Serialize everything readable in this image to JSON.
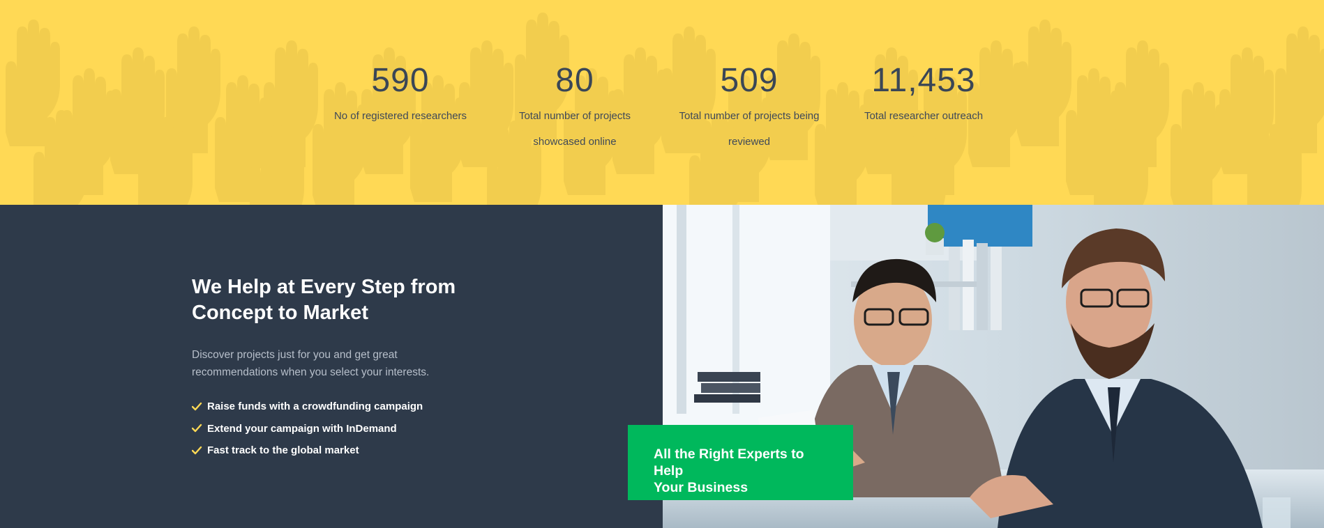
{
  "stats": [
    {
      "number": "590",
      "label_lines": [
        "No of registered researchers"
      ]
    },
    {
      "number": "80",
      "label_lines": [
        "Total number of projects",
        "showcased online"
      ]
    },
    {
      "number": "509",
      "label_lines": [
        "Total number of projects being",
        "reviewed"
      ]
    },
    {
      "number": "11,453",
      "label_lines": [
        "Total researcher outreach"
      ]
    }
  ],
  "feature": {
    "heading_line1": "We Help at Every Step from",
    "heading_line2": "Concept to Market",
    "description": "Discover projects just for you and get great recommendations when you select your interests.",
    "checklist": [
      "Raise funds with a crowdfunding campaign",
      "Extend your campaign with InDemand",
      "Fast track to the global market"
    ],
    "cta_line1": "All the Right Experts to Help",
    "cta_line2": "Your Business"
  },
  "colors": {
    "stats_background": "#ffd955",
    "hands_pattern": "#f2cd4e",
    "section_background": "#2e3a4a",
    "check_icon": "#ffd955",
    "cta_background": "#00b85c"
  },
  "icons": {
    "check": "check-icon",
    "background_pattern": "raised-hands-pattern",
    "photo": "business-meeting-photo"
  }
}
